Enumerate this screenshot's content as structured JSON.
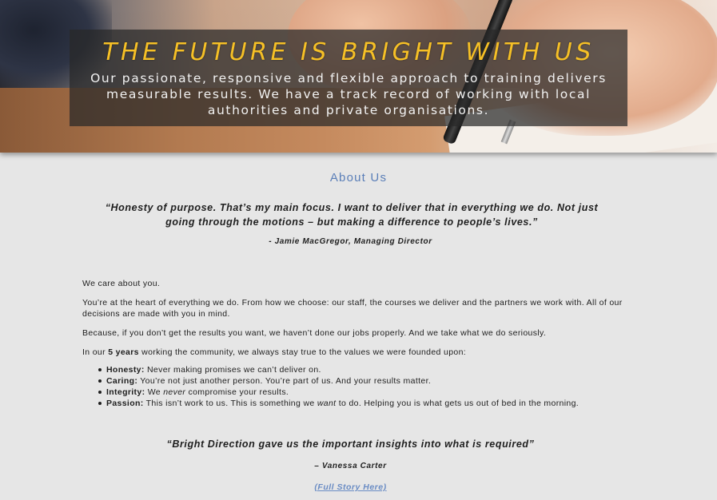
{
  "hero": {
    "title": "THE FUTURE IS BRIGHT WITH US",
    "subtitle": "Our passionate, responsive and flexible approach to training delivers measurable results. We have a track record of working with local authorities and private organisations."
  },
  "about": {
    "title": "About Us",
    "quote": "“Honesty of purpose. That’s my main focus. I want to deliver that in everything we do. Not just going through the motions – but making a difference to people’s lives.”",
    "quote_author": "- Jamie MacGregor, Managing Director",
    "paragraphs": [
      "We care about you.",
      "You’re at the heart of everything we do. From how we choose: our staff, the courses we deliver and the partners we work with. All of our decisions are made with you in mind.",
      "Because, if you don’t get the results you want, we haven’t done our jobs properly. And we take what we do seriously."
    ],
    "years_intro_prefix": "In our ",
    "years_value": "5 years",
    "years_intro_suffix": " working the community, we always stay true to the values we were founded upon:",
    "values": [
      {
        "name": "Honesty:",
        "text_before": " Never making promises we can’t deliver on.",
        "emph": "",
        "text_after": ""
      },
      {
        "name": "Caring:",
        "text_before": " You’re not just another person. You’re part of us. And your results matter.",
        "emph": "",
        "text_after": ""
      },
      {
        "name": "Integrity:",
        "text_before": " We ",
        "emph": "never",
        "text_after": " compromise your results."
      },
      {
        "name": "Passion:",
        "text_before": " This isn’t work to us. This is something we ",
        "emph": "want",
        "text_after": " to do. Helping you is what gets us out of bed in the morning."
      }
    ],
    "testimonial": "“Bright Direction gave us the important insights into what is required”",
    "testimonial_author": "– Vanessa Carter",
    "story_link": "(Full Story Here)"
  }
}
